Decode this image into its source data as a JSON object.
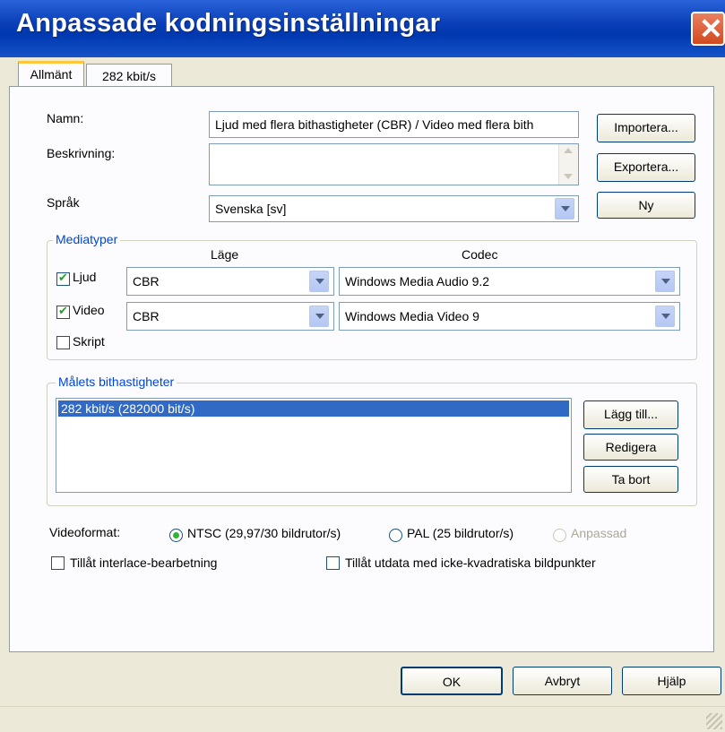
{
  "window": {
    "title": "Anpassade kodningsinställningar",
    "close_glyph": "✕"
  },
  "tabs": [
    {
      "label": "Allmänt",
      "active": true
    },
    {
      "label": "282 kbit/s",
      "active": false
    }
  ],
  "general": {
    "name_label": "Namn:",
    "name_value": "Ljud med flera bithastigheter (CBR) / Video med flera bith",
    "description_label": "Beskrivning:",
    "description_value": "",
    "language_label": "Språk",
    "language_value": "Svenska [sv]"
  },
  "buttons": {
    "import": "Importera...",
    "export": "Exportera...",
    "new": "Ny",
    "add": "Lägg till...",
    "edit": "Redigera",
    "remove": "Ta bort",
    "ok": "OK",
    "cancel": "Avbryt",
    "help": "Hjälp"
  },
  "media_types": {
    "legend": "Mediatyper",
    "mode_header": "Läge",
    "codec_header": "Codec",
    "audio": {
      "label": "Ljud",
      "checked": true,
      "mode": "CBR",
      "codec": "Windows Media Audio 9.2"
    },
    "video": {
      "label": "Video",
      "checked": true,
      "mode": "CBR",
      "codec": "Windows Media Video 9"
    },
    "script": {
      "label": "Skript",
      "checked": false
    }
  },
  "bitrates": {
    "legend": "Målets bithastigheter",
    "items": [
      "282 kbit/s (282000 bit/s)"
    ]
  },
  "videoformat": {
    "label": "Videoformat:",
    "options": [
      {
        "label": "NTSC (29,97/30 bildrutor/s)",
        "selected": true,
        "enabled": true
      },
      {
        "label": "PAL (25 bildrutor/s)",
        "selected": false,
        "enabled": true
      },
      {
        "label": "Anpassad",
        "selected": false,
        "enabled": false
      }
    ],
    "interlace_label": "Tillåt interlace-bearbetning",
    "interlace_checked": false,
    "nonsquare_label": "Tillåt utdata med icke-kvadratiska bildpunkter",
    "nonsquare_checked": false
  },
  "colors": {
    "titlebar": "#0a3fb8",
    "accent": "#0046d5",
    "selection": "#316ac5",
    "tab_highlight": "#ffc83c"
  }
}
